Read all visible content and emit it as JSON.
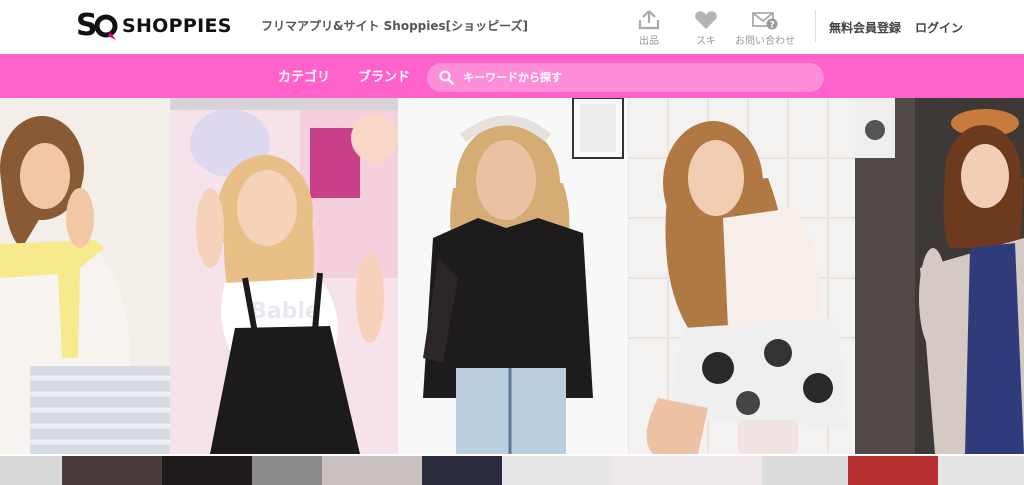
{
  "header": {
    "logo_text": "SHOPPIES",
    "tagline": "フリマアプリ&サイト Shoppies[ショッピーズ]",
    "icons": [
      {
        "name": "upload-icon",
        "label": "出品"
      },
      {
        "name": "heart-icon",
        "label": "スキ"
      },
      {
        "name": "mail-question-icon",
        "label": "お問い合わせ"
      }
    ],
    "register_label": "無料会員登録",
    "login_label": "ログイン"
  },
  "nav": {
    "category_label": "カテゴリ",
    "brand_label": "ブランド",
    "search_placeholder": "キーワードから探す"
  },
  "colors": {
    "accent_pink": "#ff63cb",
    "search_pink": "#ff8ed8",
    "logo_magenta": "#e6007e"
  },
  "hero_photos": [
    {
      "name": "model-photo-1"
    },
    {
      "name": "model-photo-2"
    },
    {
      "name": "model-photo-3"
    },
    {
      "name": "model-photo-4"
    },
    {
      "name": "model-photo-5"
    }
  ]
}
